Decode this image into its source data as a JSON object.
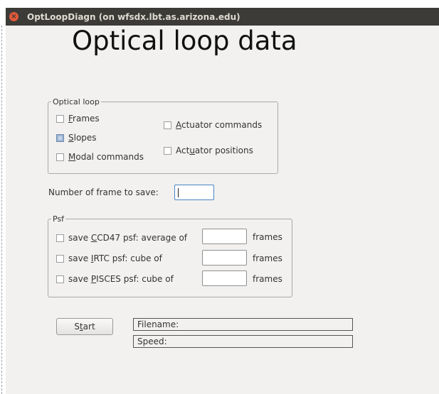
{
  "window": {
    "title": "OptLoopDiagn (on wfsdx.lbt.as.arizona.edu)",
    "close_glyph": "×"
  },
  "heading": "Optical loop data",
  "optical_loop": {
    "legend": "Optical loop",
    "frames": {
      "pre": "",
      "mn": "F",
      "post": "rames",
      "checked": false
    },
    "slopes": {
      "pre": "",
      "mn": "S",
      "post": "lopes",
      "checked": true
    },
    "modal_commands": {
      "pre": "",
      "mn": "M",
      "post": "odal commands",
      "checked": false
    },
    "actuator_commands": {
      "pre": "",
      "mn": "A",
      "post": "ctuator commands",
      "checked": false
    },
    "actuator_positions": {
      "pre": "Act",
      "mn": "u",
      "post": "ator positions",
      "checked": false
    }
  },
  "frames_to_save": {
    "label": "Number of frame to save:",
    "value": ""
  },
  "psf": {
    "legend": "Psf",
    "ccd47": {
      "pre": "save ",
      "mn": "C",
      "post": "CD47 psf: average of",
      "value": "",
      "unit": "frames",
      "checked": false
    },
    "irtc": {
      "pre": "save ",
      "mn": "I",
      "post": "RTC psf: cube of",
      "value": "",
      "unit": "frames",
      "checked": false
    },
    "pisces": {
      "pre": "save ",
      "mn": "P",
      "post": "ISCES psf: cube of",
      "value": "",
      "unit": "frames",
      "checked": false
    }
  },
  "start_button": {
    "pre": "S",
    "mn": "t",
    "post": "art"
  },
  "status": {
    "filename_label": "Filename:",
    "speed_label": "Speed:"
  }
}
